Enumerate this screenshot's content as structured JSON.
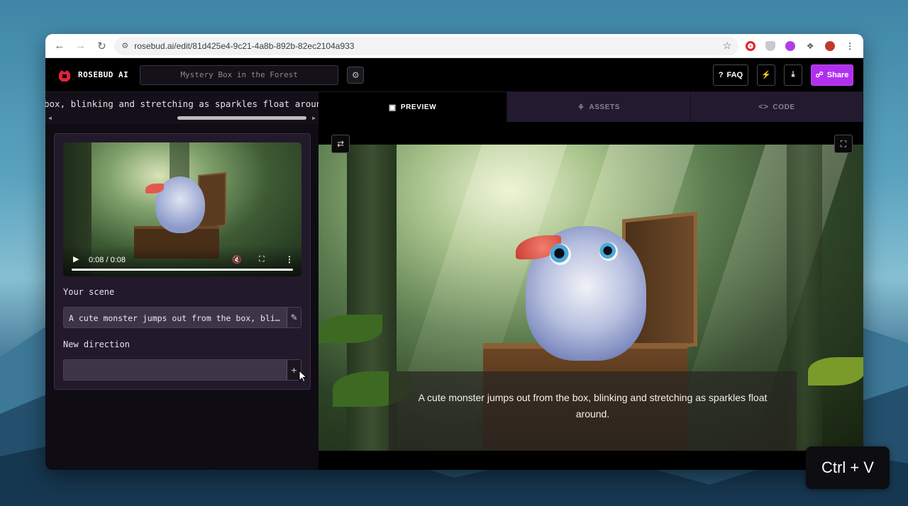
{
  "browser": {
    "url": "rosebud.ai/edit/81d425e4-9c21-4a8b-892b-82ec2104a933"
  },
  "app": {
    "logo_text": "ROSEBUD AI",
    "project_title": "Mystery Box in the Forest",
    "header_buttons": {
      "faq_label": "FAQ",
      "share_label": "Share"
    },
    "accent_color": "#b12ff0"
  },
  "left_panel": {
    "prompt_strip_text": "box, blinking and stretching as sparkles float around.",
    "video": {
      "time": "0:08 / 0:08",
      "progress_fraction": 1.0
    },
    "your_scene_label": "Your scene",
    "your_scene_value": "A cute monster jumps out from the box, blinking and stretching as sparkles float around.",
    "new_direction_label": "New direction",
    "new_direction_value": ""
  },
  "right_panel": {
    "tabs": [
      {
        "label": "PREVIEW",
        "icon": "image-icon",
        "active": true
      },
      {
        "label": "ASSETS",
        "icon": "assets-icon",
        "active": false
      },
      {
        "label": "CODE",
        "icon": "code-icon",
        "active": false
      }
    ],
    "caption": "A cute monster jumps out from the box, blinking and stretching as sparkles float around."
  },
  "overlay_hint": "Ctrl + V"
}
